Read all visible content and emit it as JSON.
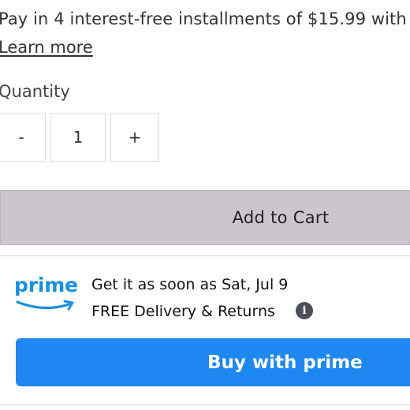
{
  "payment": {
    "installments_text": "Pay in 4 interest-free installments of $15.99 with",
    "learn_more": "Learn more"
  },
  "quantity": {
    "label": "Quantity",
    "minus": "-",
    "value": "1",
    "plus": "+"
  },
  "cart": {
    "add_label": "Add to Cart"
  },
  "prime": {
    "logo_text": "prime",
    "delivery_line1": "Get it as soon as Sat, Jul 9",
    "delivery_line2": "FREE Delivery & Returns",
    "info_glyph": "i",
    "buy_label": "Buy with prime"
  },
  "colors": {
    "prime_blue": "#1e88f0",
    "cart_button_bg": "#ccc6cc",
    "info_icon_bg": "#4a4f55"
  },
  "icons": [
    "prime-smile-icon",
    "info-icon"
  ]
}
